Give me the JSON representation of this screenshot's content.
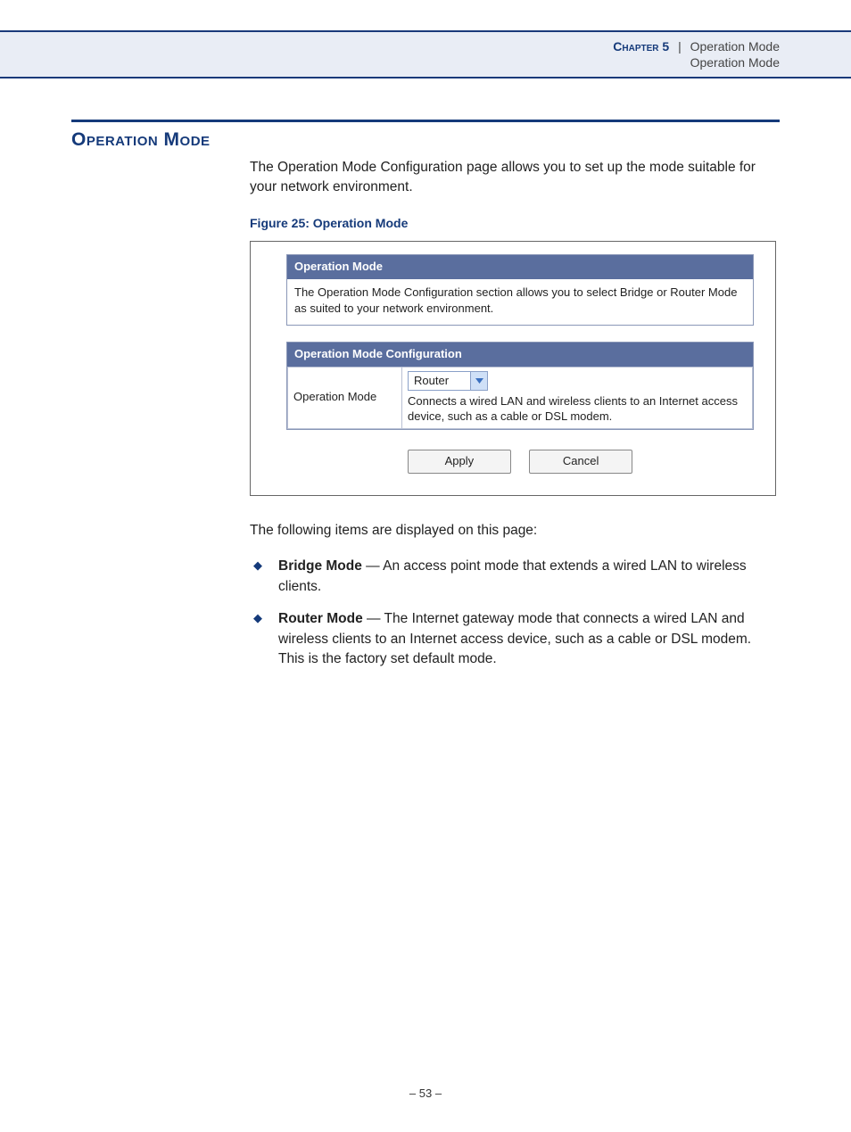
{
  "header": {
    "chapter_label": "Chapter 5",
    "separator": "|",
    "title": "Operation Mode",
    "subtitle": "Operation Mode"
  },
  "section": {
    "title": "Operation Mode",
    "intro": "The Operation Mode Configuration page allows you to set up the mode suitable for your network environment.",
    "figure_caption": "Figure 25:  Operation Mode"
  },
  "figure": {
    "panel1": {
      "header": "Operation Mode",
      "body": "The Operation Mode Configuration section allows you to select Bridge or Router Mode as suited to your network environment."
    },
    "panel2": {
      "header": "Operation Mode Configuration",
      "row_label": "Operation Mode",
      "dropdown_value": "Router",
      "description": "Connects a wired LAN and wireless clients to an Internet access device, such as a cable or DSL modem."
    },
    "buttons": {
      "apply": "Apply",
      "cancel": "Cancel"
    }
  },
  "items_intro": "The following items are displayed on this page:",
  "bullets": [
    {
      "term": "Bridge Mode",
      "desc": " — An access point mode that extends a wired LAN to wireless clients."
    },
    {
      "term": "Router Mode",
      "desc": " — The Internet gateway mode that connects a wired LAN and wireless clients to an Internet access device, such as a cable or DSL modem. This is the factory set default mode."
    }
  ],
  "footer": {
    "page": "–  53  –"
  }
}
